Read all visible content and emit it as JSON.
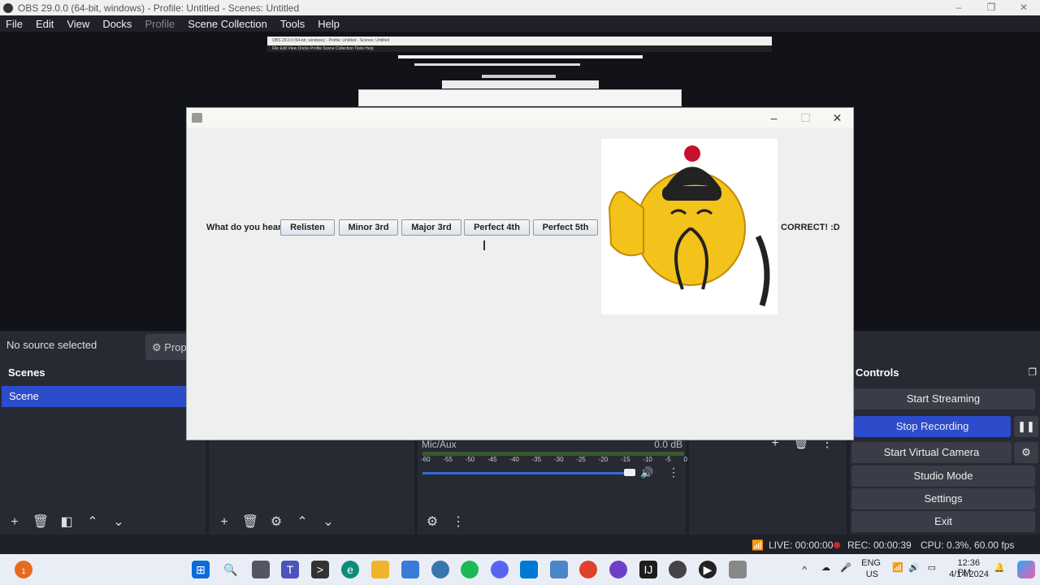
{
  "window": {
    "title": "OBS 29.0.0 (64-bit, windows) - Profile: Untitled - Scenes: Untitled",
    "controls": [
      "–",
      "❐",
      "✕"
    ]
  },
  "menu": [
    "File",
    "Edit",
    "View",
    "Docks",
    "Profile",
    "Scene Collection",
    "Tools",
    "Help"
  ],
  "preview": {
    "nested_title": "OBS 29.0.0 (64-bit, windows) - Profile: Untitled - Scenes: Untitled",
    "nested_menu": "File  Edit  View  Docks  Profile  Scene Collection  Tools  Help"
  },
  "sources_bar": {
    "status": "No source selected",
    "properties_label": "Prope"
  },
  "scenes": {
    "header": "Scenes",
    "items": [
      "Scene"
    ]
  },
  "mixer": {
    "label": "Mic/Aux",
    "level": "0.0 dB",
    "scale": [
      "-60",
      "-55",
      "-50",
      "-45",
      "-40",
      "-35",
      "-30",
      "-25",
      "-20",
      "-15",
      "-10",
      "-5",
      "0"
    ],
    "volume_fraction": 0.8
  },
  "controls": {
    "header": "Controls",
    "start_streaming": "Start Streaming",
    "stop_recording": "Stop Recording",
    "start_virtual_camera": "Start Virtual Camera",
    "studio_mode": "Studio Mode",
    "settings": "Settings",
    "exit": "Exit"
  },
  "status": {
    "live": "LIVE: 00:00:00",
    "rec": "REC: 00:00:39",
    "cpu": "CPU: 0.3%, 60.00 fps"
  },
  "app_window": {
    "prompt": "What do you hear?",
    "buttons": [
      "Relisten",
      "Minor 3rd",
      "Major 3rd",
      "Perfect 4th",
      "Perfect 5th"
    ],
    "result": "CORRECT! :D",
    "controls": [
      "–",
      "☐",
      "✕"
    ]
  },
  "taskbar": {
    "notification_count": "1",
    "lang_line1": "ENG",
    "lang_line2": "US",
    "time": "12:36 PM",
    "date": "4/14/2024"
  },
  "colors": {
    "accent": "#2c4ccb",
    "dock_bg": "#272a33",
    "app_bg": "#efefef"
  }
}
